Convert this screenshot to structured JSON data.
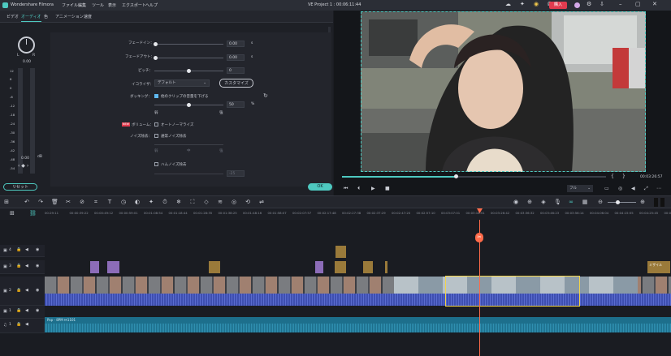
{
  "app": {
    "name": "Wondershare Filmora",
    "project_title": "VE Project 1 : 00:06:11:44"
  },
  "menu": [
    "ファイル",
    "編集",
    "ツール",
    "表示",
    "エクスポート",
    "ヘルプ"
  ],
  "titlebar": {
    "buy_label": "購入"
  },
  "tabs": [
    "ビデオ",
    "オーディオ",
    "色",
    "アニメーション",
    "速度"
  ],
  "active_tab": "オーディオ",
  "meter": {
    "labels": [
      "L",
      "R"
    ],
    "value": "0.00",
    "scale": [
      "12",
      "6",
      "0",
      "-6",
      "-12",
      "-18",
      "-24",
      "-30",
      "-36",
      "-42",
      "-48",
      "-54"
    ],
    "unit": "dB",
    "bottom_value": "0.00"
  },
  "audio": {
    "fade_in": {
      "label": "フェードイン：",
      "value": "0.00",
      "unit": "s"
    },
    "fade_out": {
      "label": "フェードアウト：",
      "value": "0.00",
      "unit": "s"
    },
    "pitch": {
      "label": "ピッチ：",
      "value": "0"
    },
    "equalizer": {
      "label": "イコライザ：",
      "value": "デフォルト",
      "customize_label": "カスタマイズ"
    },
    "ducking": {
      "label": "ダッキング：",
      "checkbox_label": "他のクリップの音量を下げる",
      "value": "50",
      "unit": "%",
      "low": "弱",
      "high": "強"
    },
    "volume": {
      "badge": "NEW",
      "label": "ボリューム：",
      "checkbox_label": "オートノーマライズ"
    },
    "denoise": {
      "label": "ノイズ除去：",
      "checkbox_label": "通常ノイズ除去",
      "ticks": [
        "弱",
        "中",
        "強"
      ]
    },
    "hum": {
      "checkbox_label": "ハムノイズ除去",
      "value": "-25"
    }
  },
  "reset_label": "リセット",
  "ok_label": "OK",
  "player": {
    "time": "00:03:26:57",
    "speed": "フル",
    "braces": [
      "{",
      "}"
    ],
    "progress": 0.43
  },
  "ruler": {
    "ticks": [
      "00:29:11",
      "00:00:39:22",
      "00:00:49:12",
      "00:00:59:01",
      "00:01:08:54",
      "00:01:18:44",
      "00:01:28:35",
      "00:01:38:25",
      "00:01:48:16",
      "00:01:58:07",
      "00:02:07:57",
      "00:02:17:48",
      "00:02:27:38",
      "00:02:37:29",
      "00:02:47:20",
      "00:02:57:10",
      "00:03:07:01",
      "00:03:16:51",
      "00:03:26:42",
      "00:03:36:32",
      "00:03:46:23",
      "00:03:56:14",
      "00:04:06:04",
      "00:04:15:55",
      "00:04:25:45",
      "00:04:35:36"
    ]
  },
  "tracks": {
    "labels": [
      "4",
      "3",
      "2",
      "1",
      "1"
    ],
    "audio_clip": "Pop - 8PM Ｍ1101",
    "title_clip": "ミザイル"
  },
  "colors": {
    "accent": "#4ec9c0",
    "playhead": "#ff6b4a",
    "audio_wave": "#2f8fb0",
    "video_wave": "#3e4fb0"
  }
}
